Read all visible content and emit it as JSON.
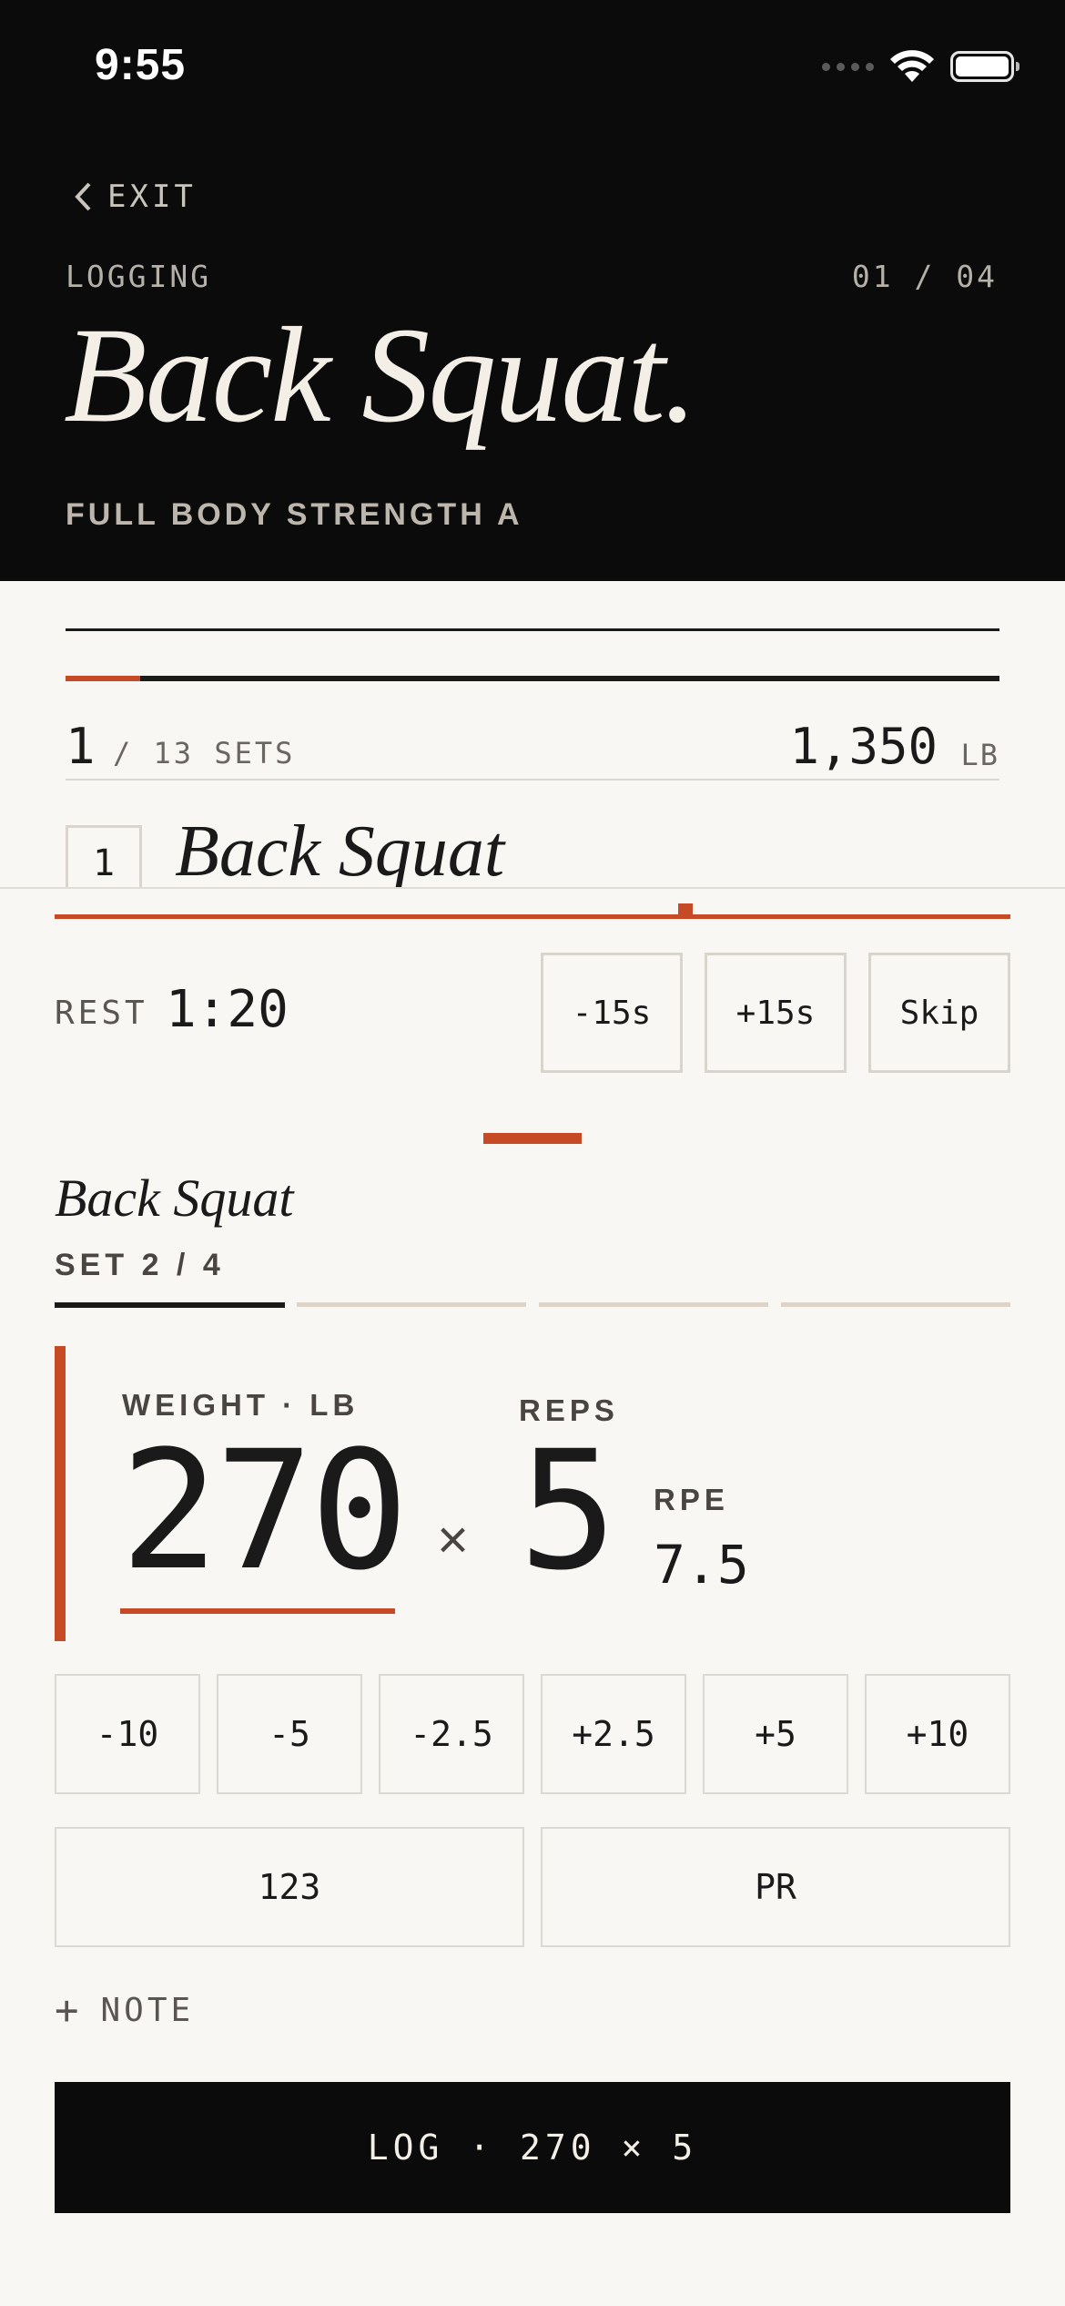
{
  "status_bar": {
    "time": "9:55"
  },
  "header": {
    "exit_label": "EXIT",
    "mode_label": "LOGGING",
    "counter": "01 / 04",
    "title": "Back Squat.",
    "program": "FULL BODY STRENGTH A"
  },
  "summary": {
    "sets_done": "1",
    "sets_label": "/ 13 SETS",
    "total": "1,350",
    "total_unit": "LB",
    "session_progress": 0.08
  },
  "peek": {
    "index": "1",
    "title": "Back Squat"
  },
  "rest": {
    "label": "REST",
    "time": "1:20",
    "progress": 0.66,
    "buttons": [
      "-15s",
      "+15s",
      "Skip"
    ]
  },
  "exercise": {
    "title": "Back Squat",
    "set_label": "SET 2 / 4",
    "current_set": 1,
    "total_sets": 4
  },
  "entry": {
    "weight_label": "WEIGHT · LB",
    "weight": "270",
    "times": "×",
    "reps_label": "REPS",
    "reps": "5",
    "rpe_label": "RPE",
    "rpe": "7.5"
  },
  "steppers": [
    "-10",
    "-5",
    "-2.5",
    "+2.5",
    "+5",
    "+10"
  ],
  "actions": {
    "keypad": "123",
    "pr": "PR"
  },
  "note_label": "NOTE",
  "log_button": "LOG · 270 × 5",
  "colors": {
    "accent": "#c64a26",
    "ink": "#0b0b0b",
    "paper": "#f8f7f4"
  }
}
